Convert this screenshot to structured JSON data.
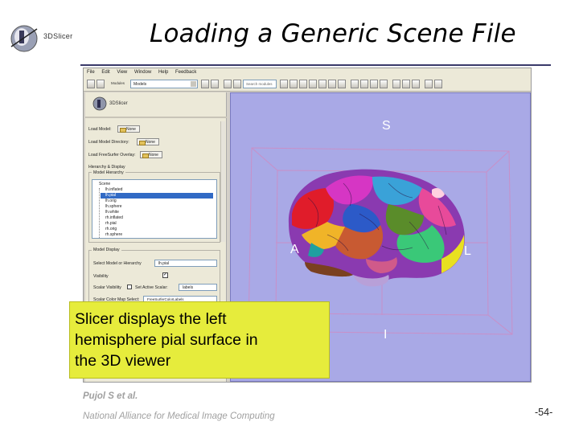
{
  "slide": {
    "title": "Loading a Generic Scene File",
    "logo_text": "3DSlicer",
    "callout_lines": [
      "Slicer displays the left",
      "hemisphere pial surface in",
      "the 3D viewer"
    ],
    "footer_author": "Pujol S et al.",
    "footer_org": "National Alliance for Medical Image Computing",
    "page_number": "-54-"
  },
  "app": {
    "menu": [
      "File",
      "Edit",
      "View",
      "Window",
      "Help",
      "Feedback"
    ],
    "toolbar": {
      "modules_label": "Modules",
      "module_value": "Models",
      "search_placeholder": "Search modules"
    },
    "panel": {
      "logo_text": "3DSlicer",
      "load_model_label": "Load Model:",
      "load_model_dir_label": "Load Model Directory:",
      "load_freesurfer_label": "Load FreeSurfer Overlay:",
      "none_button": "None",
      "hierarchy_section": "Hierarchy & Display",
      "model_hierarchy_label": "Model Hierarchy",
      "tree_items": [
        "Scene",
        "lh.inflated",
        "lh.pial",
        "lh.orig",
        "lh.sphere",
        "lh.white",
        "rh.inflated",
        "rh.pial",
        "rh.orig",
        "rh.sphere"
      ],
      "selected_tree_index": 2,
      "model_display_label": "Model Display",
      "select_model_label": "Select Model or Hierarchy",
      "select_model_value": "lh.pial",
      "visibility_label": "Visibility",
      "scalar_visibility_label": "Scalar Visibility",
      "set_active_scalar_label": "Set Active Scalar:",
      "active_scalar_value": "labels",
      "scalar_color_map_label": "Scalar Color Map Select:",
      "scalar_color_map_value": "FreeSurferColorLabels"
    },
    "viewer": {
      "background": "#a9a9e6",
      "labels": {
        "superior": "S",
        "anterior": "A",
        "left": "L",
        "inferior": "I"
      }
    }
  }
}
